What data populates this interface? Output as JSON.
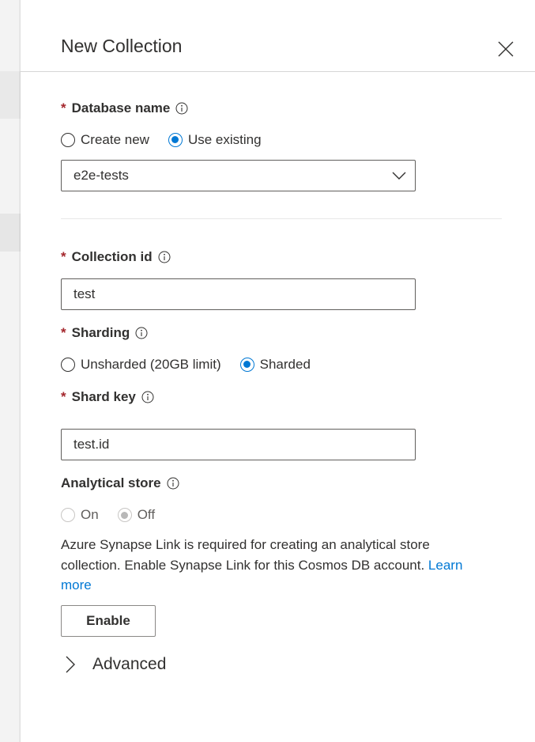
{
  "panel": {
    "title": "New Collection"
  },
  "database": {
    "required_mark": "*",
    "label": "Database name",
    "options": [
      "Create new",
      "Use existing"
    ],
    "selected": "Use existing",
    "selected_value": "e2e-tests"
  },
  "collection": {
    "required_mark": "*",
    "label": "Collection id",
    "value": "test"
  },
  "sharding": {
    "required_mark": "*",
    "label": "Sharding",
    "options": [
      "Unsharded (20GB limit)",
      "Sharded"
    ],
    "selected": "Sharded"
  },
  "shard_key": {
    "required_mark": "*",
    "label": "Shard key",
    "value": "test.id"
  },
  "analytical_store": {
    "label": "Analytical store",
    "options": [
      "On",
      "Off"
    ],
    "selected": "Off",
    "disabled": true,
    "description": "Azure Synapse Link is required for creating an analytical store collection. Enable Synapse Link for this Cosmos DB account.",
    "link_text": "Learn more",
    "enable_button": "Enable"
  },
  "advanced": {
    "label": "Advanced"
  },
  "colors": {
    "accent": "#0078d4",
    "required": "#a4262c",
    "text": "#323130"
  }
}
